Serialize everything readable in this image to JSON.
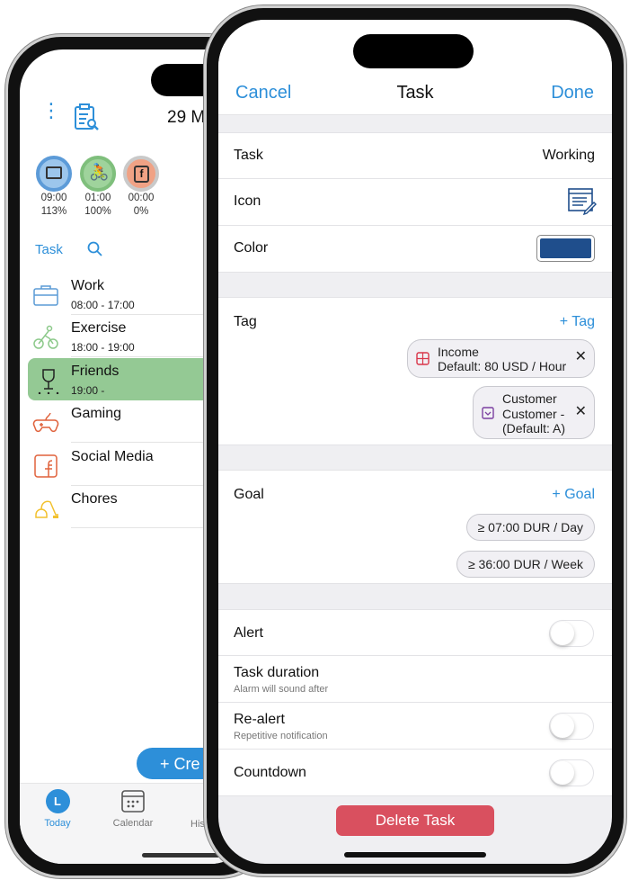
{
  "left_phone": {
    "header": {
      "date_partial": "29 M"
    },
    "summary": [
      {
        "icon": "briefcase-icon",
        "time": "09:00",
        "percent": "113%",
        "color": "#9cc6ec"
      },
      {
        "icon": "bicycle-icon",
        "time": "01:00",
        "percent": "100%",
        "color": "#9fd39c"
      },
      {
        "icon": "facebook-icon",
        "time": "00:00",
        "percent": "0%",
        "color": "#f0a285"
      }
    ],
    "task_label": "Task",
    "tasks": [
      {
        "name": "Work",
        "time": "08:00 - 17:00",
        "icon": "briefcase-icon",
        "color": "#5b9bd5"
      },
      {
        "name": "Exercise",
        "time": "18:00 - 19:00",
        "icon": "bicycle-icon",
        "color": "#8cc98a"
      },
      {
        "name": "Friends",
        "time": "19:00 -",
        "icon": "wine-glass-icon",
        "color": "#222222",
        "selected": true
      },
      {
        "name": "Gaming",
        "time": "",
        "icon": "gamepad-icon",
        "color": "#e0623c"
      },
      {
        "name": "Social Media",
        "time": "",
        "icon": "facebook-icon",
        "color": "#e0623c"
      },
      {
        "name": "Chores",
        "time": "",
        "icon": "vacuum-icon",
        "color": "#f2c12e"
      }
    ],
    "create_button_partial": "+ Cre",
    "tabs": [
      {
        "label": "Today",
        "active": true
      },
      {
        "label": "Calendar"
      },
      {
        "label": "His"
      }
    ],
    "selected_color": "#94c994"
  },
  "right_phone": {
    "nav": {
      "cancel": "Cancel",
      "title": "Task",
      "done": "Done"
    },
    "task": {
      "label": "Task",
      "value": "Working"
    },
    "icon": {
      "label": "Icon",
      "value": "notes-edit-icon"
    },
    "color": {
      "label": "Color",
      "value": "#1f4e8c"
    },
    "tag": {
      "label": "Tag",
      "add": "+ Tag",
      "chips": [
        {
          "line1": "Income",
          "line2": "Default: 80 USD / Hour",
          "icon": "calculator-icon"
        },
        {
          "line1": "Customer",
          "line2": "Customer -",
          "line3": "(Default: A)",
          "icon": "dropdown-box-icon"
        }
      ]
    },
    "goal": {
      "label": "Goal",
      "add": "+ Goal",
      "chips": [
        "≥ 07:00 DUR / Day",
        "≥ 36:00 DUR / Week"
      ]
    },
    "alert": {
      "label": "Alert",
      "on": false
    },
    "task_duration": {
      "label": "Task duration",
      "sub": "Alarm will sound after"
    },
    "realert": {
      "label": "Re-alert",
      "sub": "Repetitive notification",
      "on": false
    },
    "countdown": {
      "label": "Countdown",
      "on": false
    },
    "delete": "Delete Task",
    "accent": "#2d8fd9",
    "delete_color": "#d9505f"
  }
}
